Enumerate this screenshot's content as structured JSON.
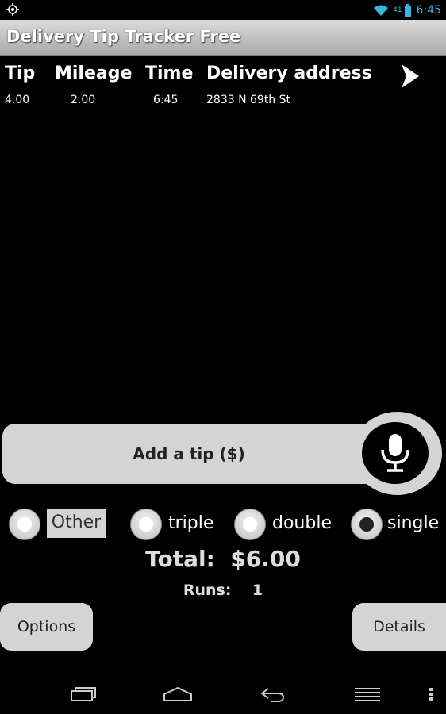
{
  "status_bar": {
    "left_icon": "gps-icon",
    "wifi_icon": "wifi-icon",
    "signal_text": "41",
    "battery_icon": "battery-icon",
    "time": "6:45",
    "accent_color": "#33b5e5"
  },
  "app": {
    "title": "Delivery Tip Tracker Free"
  },
  "table": {
    "headers": [
      "Tip",
      "Mileage",
      "Time",
      "Delivery address"
    ],
    "rows": [
      {
        "tip": "4.00",
        "mileage": "2.00",
        "time": "6:45",
        "address": "2833 N 69th St"
      }
    ],
    "next_icon": "chevron-right-icon"
  },
  "add_tip": {
    "label": "Add a tip ($)",
    "mic_icon": "microphone-icon"
  },
  "multiplier": {
    "options": [
      {
        "label": "Other",
        "checked": false
      },
      {
        "label": "triple",
        "checked": false
      },
      {
        "label": "double",
        "checked": false
      },
      {
        "label": "single",
        "checked": true
      }
    ]
  },
  "summary": {
    "total_label": "Total:",
    "total_value": "$6.00",
    "runs_label": "Runs:",
    "runs_value": "1"
  },
  "buttons": {
    "options": "Options",
    "details": "Details"
  },
  "nav": {
    "recent_icon": "recent-apps-icon",
    "home_icon": "home-icon",
    "back_icon": "back-icon",
    "menu_icon": "menu-icon",
    "overflow_icon": "overflow-menu-icon"
  }
}
